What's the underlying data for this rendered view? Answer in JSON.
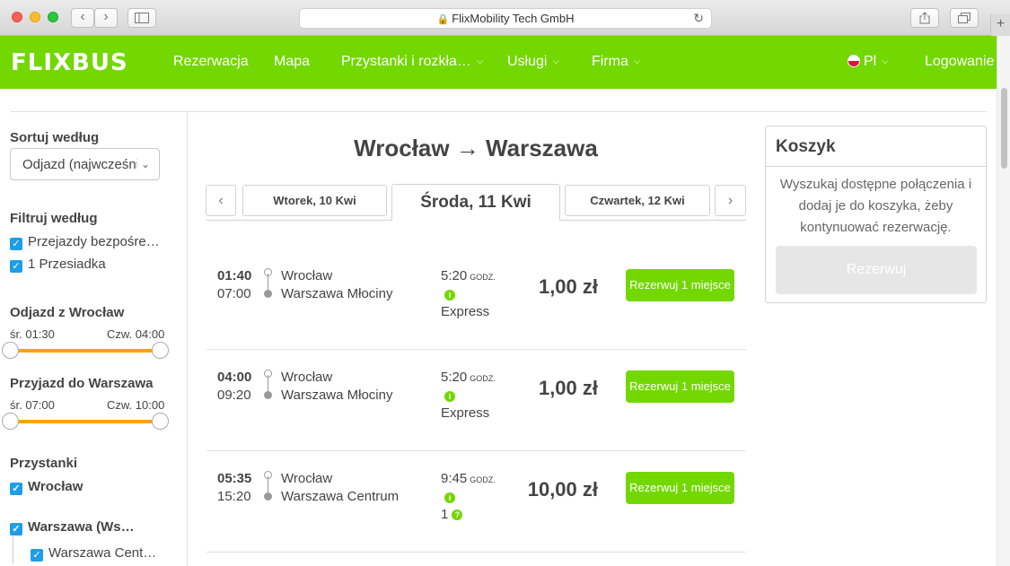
{
  "browser": {
    "address": "FlixMobility Tech GmbH"
  },
  "nav": {
    "logo": "FLIXBUS",
    "links": [
      "Rezerwacja",
      "Mapa",
      "Przystanki i rozkła…",
      "Usługi",
      "Firma"
    ],
    "language": "Pl",
    "login": "Logowanie"
  },
  "sidebar": {
    "sort_label": "Sortuj według",
    "sort_value": "Odjazd (najwcześni",
    "filter_label": "Filtruj według",
    "filters": [
      "Przejazdy bezpośre…",
      "1 Przesiadka"
    ],
    "departure_label": "Odjazd z Wrocław",
    "departure_min": "śr. 01:30",
    "departure_max": "Czw. 04:00",
    "arrival_label": "Przyjazd do Warszawa",
    "arrival_min": "śr. 07:00",
    "arrival_max": "Czw. 10:00",
    "stops_label": "Przystanki",
    "stops": [
      "Wrocław",
      "Warszawa (Ws…",
      "Warszawa Cent…"
    ]
  },
  "main": {
    "title": "Wrocław → Warszawa",
    "prev": "‹",
    "next": "›",
    "dates": [
      "Wtorek, 10 Kwi",
      "Środa, 11 Kwi",
      "Czwartek, 12 Kwi"
    ],
    "duration_unit": "GODZ.",
    "trips": [
      {
        "dep": "01:40",
        "arr": "07:00",
        "from": "Wrocław",
        "to": "Warszawa Młociny",
        "duration": "5:20",
        "type": "Express",
        "price": "1,00 zł",
        "button": "Rezerwuj 1 miejsce"
      },
      {
        "dep": "04:00",
        "arr": "09:20",
        "from": "Wrocław",
        "to": "Warszawa Młociny",
        "duration": "5:20",
        "type": "Express",
        "price": "1,00 zł",
        "button": "Rezerwuj 1 miejsce"
      },
      {
        "dep": "05:35",
        "arr": "15:20",
        "from": "Wrocław",
        "to": "Warszawa Centrum",
        "duration": "9:45",
        "type": "1",
        "price": "10,00 zł",
        "button": "Rezerwuj 1 miejsce"
      }
    ]
  },
  "cart": {
    "title": "Koszyk",
    "message": "Wyszukaj dostępne połączenia i dodaj je do koszyka, żeby kontynuować rezerwację.",
    "button": "Rezerwuj"
  },
  "colors": {
    "brand": "#73d700",
    "slider": "#ffa200",
    "checkbox": "#1e9ee8"
  }
}
